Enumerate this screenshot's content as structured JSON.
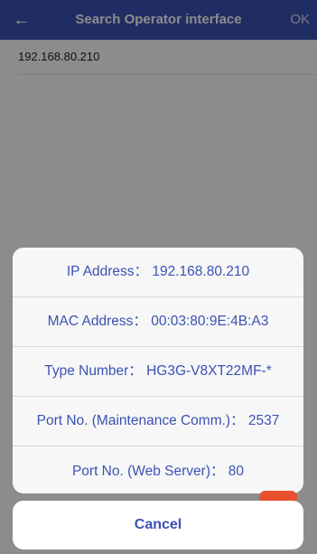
{
  "header": {
    "back_icon": "←",
    "title": "Search Operator interface",
    "ok_label": "OK"
  },
  "list": {
    "items": [
      "192.168.80.210"
    ]
  },
  "sheet": {
    "rows": [
      "IP Address：  192.168.80.210",
      "MAC Address：  00:03:80:9E:4B:A3",
      "Type Number：  HG3G-V8XT22MF-*",
      "Port No. (Maintenance Comm.)：  2537",
      "Port No. (Web Server)：  80"
    ],
    "cancel_label": "Cancel"
  },
  "colors": {
    "header_bg": "#3b52b4",
    "accent": "#3b52b4",
    "peek": "#e8502f"
  }
}
